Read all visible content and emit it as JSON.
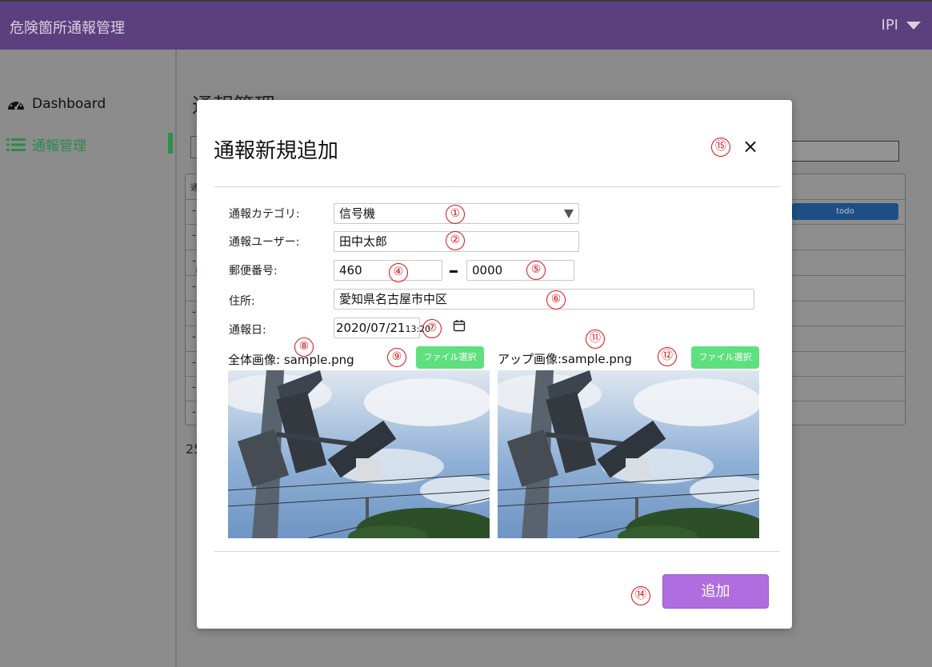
{
  "app": {
    "title": "危険箇所通報管理",
    "user": "IPI"
  },
  "sidebar": {
    "items": [
      {
        "label": "Dashboard"
      },
      {
        "label": "通報管理"
      }
    ]
  },
  "main": {
    "title": "通報管理",
    "table": {
      "header_fragment": "通",
      "row_placeholder": "-",
      "todo_label": "todo"
    },
    "footer_count": "25"
  },
  "modal": {
    "title": "通報新規追加",
    "close_glyph": "×",
    "fields": {
      "category": {
        "label": "通報カテゴリ:",
        "value": "信号機"
      },
      "user": {
        "label": "通報ユーザー:",
        "value": "田中太郎"
      },
      "zip": {
        "label": "郵便番号:",
        "first": "460",
        "second": "0000"
      },
      "address": {
        "label": "住所:",
        "value": "愛知県名古屋市中区"
      },
      "date": {
        "label": "通報日:",
        "date": "2020/07/21",
        "time": "13:20"
      }
    },
    "overall_image": {
      "label": "全体画像: sample.png",
      "button": "ファイル選択"
    },
    "closeup_image": {
      "label": "アップ画像:sample.png",
      "button": "ファイル選択"
    },
    "submit": "追加"
  },
  "markers": [
    "①",
    "②",
    "③",
    "④",
    "⑤",
    "⑥",
    "⑦",
    "⑧",
    "⑨",
    "⑩",
    "⑪",
    "⑫",
    "⑬",
    "⑭",
    "⑮"
  ],
  "colors": {
    "header": "#5c3f7e",
    "sidebar_active": "#2d8a4e",
    "file_button": "#5fe07f",
    "submit_button": "#b06de0",
    "marker": "#e0101a"
  }
}
